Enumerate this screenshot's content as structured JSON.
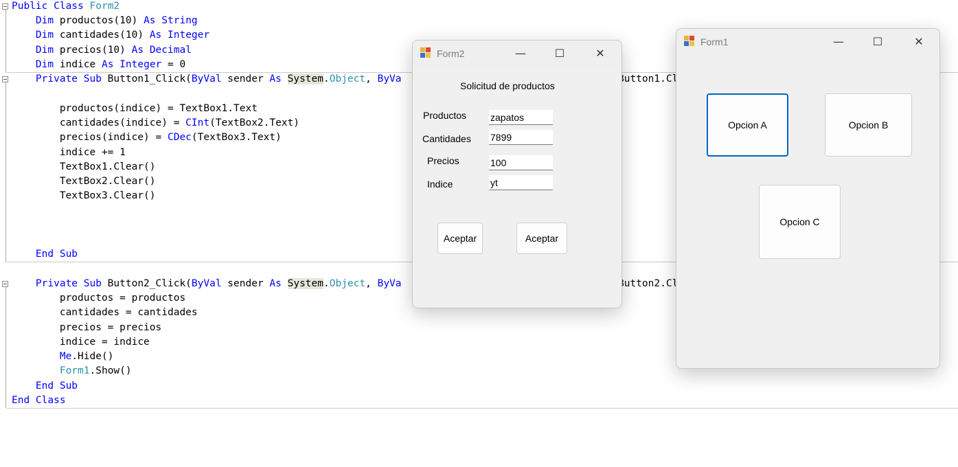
{
  "code": {
    "l1": {
      "t0": "Public Class ",
      "t1": "Form2"
    },
    "l2": {
      "t0": "Dim",
      "t1": " productos(10) ",
      "t2": "As",
      "t3": " ",
      "t4": "String"
    },
    "l3": {
      "t0": "Dim",
      "t1": " cantidades(10) ",
      "t2": "As",
      "t3": " ",
      "t4": "Integer"
    },
    "l4": {
      "t0": "Dim",
      "t1": " precios(10) ",
      "t2": "As",
      "t3": " ",
      "t4": "Decimal"
    },
    "l5": {
      "t0": "Dim",
      "t1": " indice ",
      "t2": "As",
      "t3": " ",
      "t4": "Integer",
      "t5": " = 0"
    },
    "l6": {
      "t0": "Private Sub",
      "t1": " Button1_Click(",
      "t2": "ByVal",
      "t3": " sender ",
      "t4": "As",
      "t5": " ",
      "t6": "System",
      "t7": ".",
      "t8": "Object",
      "t9": ", ",
      "t10": "ByVa",
      "t11": "Button1.Cl"
    },
    "l8": {
      "t0": "productos(indice) = TextBox1.Text"
    },
    "l9": {
      "t0": "cantidades(indice) = ",
      "t1": "CInt",
      "t2": "(TextBox2.Text)"
    },
    "l10": {
      "t0": "precios(indice) = ",
      "t1": "CDec",
      "t2": "(TextBox3.Text)"
    },
    "l11": {
      "t0": "indice += 1"
    },
    "l12": {
      "t0": "TextBox1.Clear()"
    },
    "l13": {
      "t0": "TextBox2.Clear()"
    },
    "l14": {
      "t0": "TextBox3.Clear()"
    },
    "l18": {
      "t0": "End Sub"
    },
    "l20": {
      "t0": "Private Sub",
      "t1": " Button2_Click(",
      "t2": "ByVal",
      "t3": " sender ",
      "t4": "As",
      "t5": " ",
      "t6": "System",
      "t7": ".",
      "t8": "Object",
      "t9": ", ",
      "t10": "ByVa",
      "t11": "Button2.Cl"
    },
    "l21": {
      "t0": "productos = productos"
    },
    "l22": {
      "t0": "cantidades = cantidades"
    },
    "l23": {
      "t0": "precios = precios"
    },
    "l24": {
      "t0": "indice = indice"
    },
    "l25": {
      "t0": "Me",
      "t1": ".Hide()"
    },
    "l26": {
      "t0": "Form1",
      "t1": ".Show()"
    },
    "l27": {
      "t0": "End Sub"
    },
    "l28": {
      "t0": "End Class"
    }
  },
  "form2": {
    "title": "Form2",
    "heading": "Solicitud de productos",
    "labels": {
      "productos": "Productos",
      "cantidades": "Cantidades",
      "precios": "Precios",
      "indice": "Indice"
    },
    "values": {
      "productos": "zapatos",
      "cantidades": "7899",
      "precios": "100",
      "indice": "yt"
    },
    "button1": "Aceptar",
    "button2": "Aceptar"
  },
  "form1": {
    "title": "Form1",
    "button_a": "Opcion A",
    "button_b": "Opcion B",
    "button_c": "Opcion C"
  },
  "window_controls": {
    "minimize": "—",
    "maximize": "☐",
    "close": "✕"
  },
  "colors": {
    "keyword": "#0000ff",
    "type": "#2b91af",
    "highlight": "#e6e6d8",
    "focus": "#0067c0"
  }
}
